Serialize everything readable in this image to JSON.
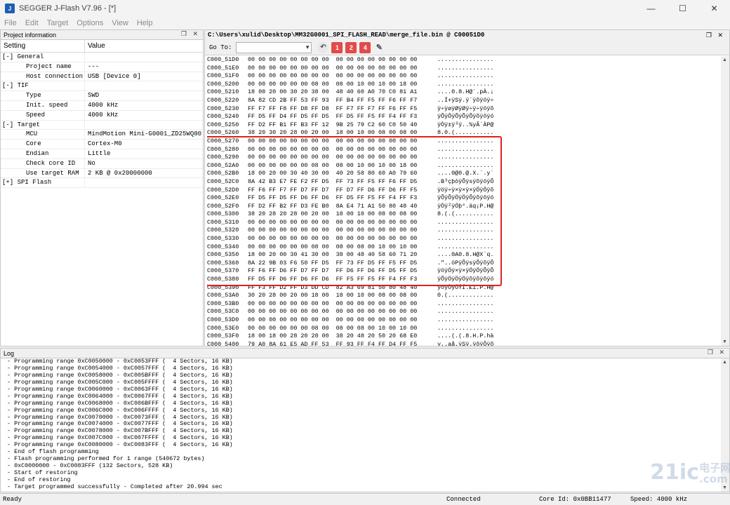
{
  "window": {
    "title": "SEGGER J-Flash V7.96 - [*]",
    "controls": {
      "minimize": "—",
      "maximize": "☐",
      "close": "✕"
    }
  },
  "menu": [
    "File",
    "Edit",
    "Target",
    "Options",
    "View",
    "Help"
  ],
  "project_panel": {
    "title": "Project information",
    "col_setting": "Setting",
    "col_value": "Value",
    "rows": [
      {
        "type": "group",
        "setting": "[-] General",
        "value": ""
      },
      {
        "type": "item",
        "setting": "Project name",
        "value": "---"
      },
      {
        "type": "item",
        "setting": "Host connection",
        "value": "USB [Device 0]"
      },
      {
        "type": "group",
        "setting": "[-] TIF",
        "value": ""
      },
      {
        "type": "item",
        "setting": "Type",
        "value": "SWD"
      },
      {
        "type": "item",
        "setting": "Init. speed",
        "value": "4000 kHz"
      },
      {
        "type": "item",
        "setting": "Speed",
        "value": "4000 kHz"
      },
      {
        "type": "group",
        "setting": "[-] Target",
        "value": ""
      },
      {
        "type": "item",
        "setting": "MCU",
        "value": "MindMotion Mini-G0001_ZD25WQ80"
      },
      {
        "type": "item",
        "setting": "Core",
        "value": "Cortex-M0"
      },
      {
        "type": "item",
        "setting": "Endian",
        "value": "Little"
      },
      {
        "type": "item",
        "setting": "Check core ID",
        "value": "No"
      },
      {
        "type": "item",
        "setting": "Use target RAM",
        "value": "2 KB @ 0x20000000"
      },
      {
        "type": "group",
        "setting": "[+] SPI Flash",
        "value": ""
      }
    ]
  },
  "hex_panel": {
    "path": "C:\\Users\\xulid\\Desktop\\MM32G0001_SPI_FLASH_READ\\merge_file.bin @ C00051D0",
    "goto_label": "Go To:",
    "toolbar_buttons": [
      "1",
      "2",
      "4"
    ],
    "rows": [
      {
        "addr": "C000_51D0",
        "bytes": "00 00 00 00 00 00 00 00  00 00 00 00 00 00 00 00",
        "ascii": "................"
      },
      {
        "addr": "C000_51E0",
        "bytes": "00 00 00 00 00 00 00 00  00 00 00 00 00 00 00 00",
        "ascii": "................"
      },
      {
        "addr": "C000_51F0",
        "bytes": "00 00 00 00 00 00 00 00  00 00 00 00 00 00 00 00",
        "ascii": "................"
      },
      {
        "addr": "C000_5200",
        "bytes": "00 00 00 00 00 00 08 00  08 00 10 00 10 00 18 00",
        "ascii": "................"
      },
      {
        "addr": "C000_5210",
        "bytes": "18 00 20 00 30 20 38 00  48 40 60 A0 70 C0 81 A1",
        "ascii": "....0.8.H@`.pÀ.¡"
      },
      {
        "addr": "C000_5220",
        "bytes": "8A 82 CD 2B FF 53 FF 93  FF B4 FF F5 FF F6 FF F7",
        "ascii": "..Í+ÿSÿ.ÿ´ÿõÿöÿ÷"
      },
      {
        "addr": "C000_5230",
        "bytes": "FF F7 FF F8 FF D8 FF D8  FF F7 FF F7 FF F6 FF F5",
        "ascii": "ÿ÷ÿøÿØÿØÿ÷ÿ÷ÿöÿõ"
      },
      {
        "addr": "C000_5240",
        "bytes": "FF D5 FF D4 FF D5 FF D5  FF D5 FF F5 FF F4 FF F3",
        "ascii": "ÿÕÿÔÿÕÿÕÿÕÿõÿôÿó"
      },
      {
        "addr": "C000_5250",
        "bytes": "FF D2 FF B1 FF B3 FF 12  9B 25 79 C2 60 C0 50 40",
        "ascii": "ÿÒÿ±ÿ³ÿ..%yÂ`ÀP@"
      },
      {
        "addr": "C000_5260",
        "bytes": "38 20 30 20 28 00 20 00  18 00 10 00 08 00 08 00",
        "ascii": "8.0.(..........."
      },
      {
        "addr": "C000_5270",
        "bytes": "00 00 00 00 00 00 00 00  00 00 00 00 00 00 00 00",
        "ascii": "................"
      },
      {
        "addr": "C000_5280",
        "bytes": "00 00 00 00 00 00 00 00  00 00 00 00 00 00 00 00",
        "ascii": "................"
      },
      {
        "addr": "C000_5290",
        "bytes": "00 00 00 00 00 00 00 00  00 00 00 00 00 00 00 00",
        "ascii": "................"
      },
      {
        "addr": "C000_52A0",
        "bytes": "00 00 00 00 00 00 08 00  08 00 10 00 10 00 18 00",
        "ascii": "................"
      },
      {
        "addr": "C000_52B0",
        "bytes": "18 00 20 00 30 40 30 00  40 20 58 80 60 A0 79 60",
        "ascii": "....0@0.@.X.`.y`"
      },
      {
        "addr": "C000_52C0",
        "bytes": "8A 42 B3 E7 FE F2 FF D5  FF 73 FF F5 FF F6 FF D5",
        "ascii": ".B³çþòÿÕÿsÿõÿöÿÕ"
      },
      {
        "addr": "C000_52D0",
        "bytes": "FF F6 FF F7 FF D7 FF D7  FF D7 FF D6 FF D6 FF F5",
        "ascii": "ÿöÿ÷ÿ×ÿ×ÿ×ÿÖÿÖÿõ"
      },
      {
        "addr": "C000_52E0",
        "bytes": "FF D5 FF D5 FF D6 FF D6  FF D5 FF F5 FF F4 FF F3",
        "ascii": "ÿÕÿÕÿÖÿÖÿÕÿõÿôÿó"
      },
      {
        "addr": "C000_52F0",
        "bytes": "FF D2 FF B2 FF D3 FE B0  8A E4 71 A1 50 80 48 40",
        "ascii": "ÿÒÿ²ÿÓþ°.äq¡P.H@"
      },
      {
        "addr": "C000_5300",
        "bytes": "38 20 28 20 28 00 20 00  18 00 10 00 08 00 08 00",
        "ascii": "8.(.(..........."
      },
      {
        "addr": "C000_5310",
        "bytes": "00 00 00 00 00 00 00 00  00 00 00 00 00 00 00 00",
        "ascii": "................"
      },
      {
        "addr": "C000_5320",
        "bytes": "00 00 00 00 00 00 00 00  00 00 00 00 00 00 00 00",
        "ascii": "................"
      },
      {
        "addr": "C000_5330",
        "bytes": "00 00 00 00 00 00 00 00  00 00 00 00 00 00 00 00",
        "ascii": "................"
      },
      {
        "addr": "C000_5340",
        "bytes": "00 00 00 00 00 00 08 00  08 00 08 00 10 00 10 00",
        "ascii": "................"
      },
      {
        "addr": "C000_5350",
        "bytes": "18 00 20 00 30 41 30 00  38 00 48 40 58 60 71 20",
        "ascii": "....0A0.8.H@X`q."
      },
      {
        "addr": "C000_5360",
        "bytes": "8A 22 9B 03 F6 50 FF D5  FF 73 FF D5 FF F5 FF D5",
        "ascii": ".\"..öPÿÕÿsÿÕÿõÿÕ"
      },
      {
        "addr": "C000_5370",
        "bytes": "FF F6 FF D6 FF D7 FF D7  FF D6 FF D6 FF D5 FF D5",
        "ascii": "ÿöÿÖÿ×ÿ×ÿÖÿÖÿÕÿÕ"
      },
      {
        "addr": "C000_5380",
        "bytes": "FF D5 FF D6 FF D6 FF D6  FF F5 FF F5 FF F4 FF F3",
        "ascii": "ÿÕÿÖÿÖÿÖÿõÿõÿôÿó"
      },
      {
        "addr": "C000_5390",
        "bytes": "FF F3 FF D2 FF D3 DD CD  82 A3 69 81 50 80 48 40",
        "ascii": "ÿóÿÒÿÓÝÍ.£i.P.H@"
      },
      {
        "addr": "C000_53A0",
        "bytes": "30 20 28 00 20 00 18 00  18 00 10 00 08 00 08 00",
        "ascii": "0.(............."
      },
      {
        "addr": "C000_53B0",
        "bytes": "00 00 00 00 00 00 00 00  00 00 00 00 00 00 00 00",
        "ascii": "................"
      },
      {
        "addr": "C000_53C0",
        "bytes": "00 00 00 00 00 00 00 00  00 00 00 00 00 00 00 00",
        "ascii": "................"
      },
      {
        "addr": "C000_53D0",
        "bytes": "00 00 00 00 00 00 00 00  00 00 00 00 00 00 00 00",
        "ascii": "................"
      },
      {
        "addr": "C000_53E0",
        "bytes": "00 00 00 00 00 00 08 00  08 00 08 00 10 00 10 00",
        "ascii": "................"
      },
      {
        "addr": "C000_53F0",
        "bytes": "18 00 18 00 28 20 28 00  38 20 48 20 50 20 68 E0",
        "ascii": "....(.(.8.H.P.hà"
      },
      {
        "addr": "C000_5400",
        "bytes": "79 A0 8A 61 E5 AD FF 53  FF 93 FF F4 FF D4 FF F5",
        "ascii": "y..aå.ÿSÿ.ÿôÿÔÿõ"
      }
    ]
  },
  "log_panel": {
    "title": "Log",
    "lines": [
      " - Programming range 0xC0050000 - 0xC0053FFF (  4 Sectors, 16 KB)",
      " - Programming range 0xC0054000 - 0xC0057FFF (  4 Sectors, 16 KB)",
      " - Programming range 0xC0058000 - 0xC005BFFF (  4 Sectors, 16 KB)",
      " - Programming range 0xC005C000 - 0xC005FFFF (  4 Sectors, 16 KB)",
      " - Programming range 0xC0060000 - 0xC0063FFF (  4 Sectors, 16 KB)",
      " - Programming range 0xC0064000 - 0xC0067FFF (  4 Sectors, 16 KB)",
      " - Programming range 0xC0068000 - 0xC006BFFF (  4 Sectors, 16 KB)",
      " - Programming range 0xC006C000 - 0xC006FFFF (  4 Sectors, 16 KB)",
      " - Programming range 0xC0070000 - 0xC0073FFF (  4 Sectors, 16 KB)",
      " - Programming range 0xC0074000 - 0xC0077FFF (  4 Sectors, 16 KB)",
      " - Programming range 0xC0078000 - 0xC007BFFF (  4 Sectors, 16 KB)",
      " - Programming range 0xC007C000 - 0xC007FFFF (  4 Sectors, 16 KB)",
      " - Programming range 0xC0080000 - 0xC0083FFF (  4 Sectors, 16 KB)",
      " - End of flash programming",
      " - Flash programming performed for 1 range (540672 bytes)",
      " - 0xC0000000 - 0xC0083FFF (132 Sectors, 528 KB)",
      " - Start of restoring",
      " - End of restoring",
      " - Target programmed successfully - Completed after 20.994 sec"
    ]
  },
  "status": {
    "left": "Ready",
    "connection": "Connected",
    "core_id": "Core Id: 0x0BB11477",
    "speed": "Speed: 4000 kHz"
  },
  "watermark": {
    "main": "21ic",
    "sub1": "电子网",
    "sub2": ".com"
  },
  "colors": {
    "highlight": "#e02020",
    "toolbar_badge": "#e34a4a"
  }
}
